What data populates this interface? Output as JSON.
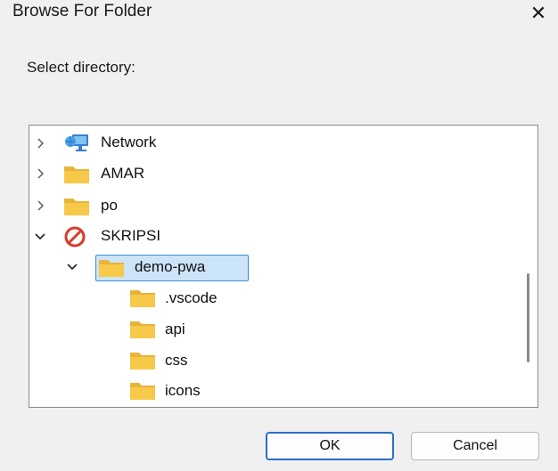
{
  "dialog": {
    "title": "Browse For Folder",
    "close_glyph": "✕",
    "prompt": "Select directory:"
  },
  "tree": {
    "items": [
      {
        "label": "Network",
        "icon": "network-icon",
        "expanded": false
      },
      {
        "label": "AMAR",
        "icon": "folder-icon",
        "expanded": false
      },
      {
        "label": "po",
        "icon": "folder-icon",
        "expanded": false
      },
      {
        "label": "SKRIPSI",
        "icon": "blocked-drive-icon",
        "expanded": true
      },
      {
        "label": "demo-pwa",
        "icon": "folder-icon",
        "expanded": true,
        "selected": true
      },
      {
        "label": ".vscode",
        "icon": "folder-icon"
      },
      {
        "label": "api",
        "icon": "folder-icon"
      },
      {
        "label": "css",
        "icon": "folder-icon"
      },
      {
        "label": "icons",
        "icon": "folder-icon"
      }
    ]
  },
  "buttons": {
    "ok": "OK",
    "cancel": "Cancel"
  },
  "colors": {
    "selection_fill": "#cce4f7",
    "selection_border": "#3c8ed8",
    "folder": "#f7c948",
    "ok_border": "#2a6fc9"
  }
}
